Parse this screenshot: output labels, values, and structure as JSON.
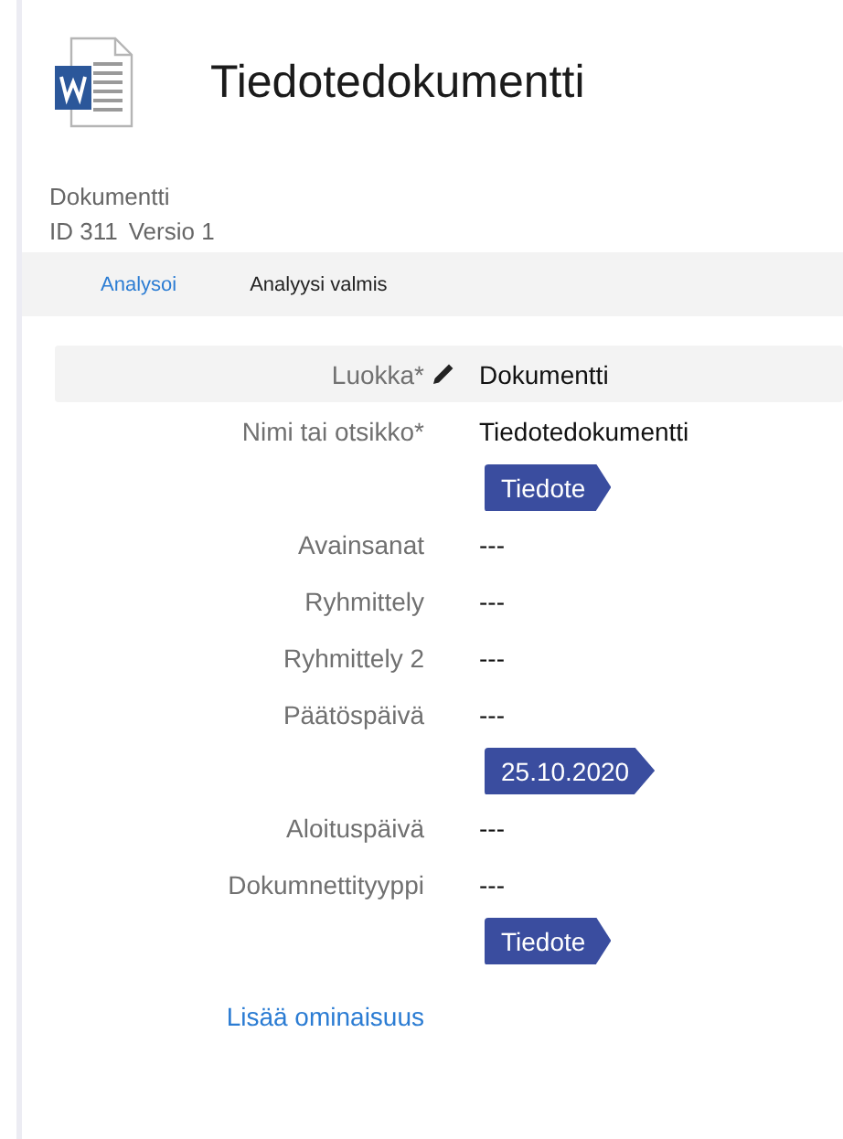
{
  "document": {
    "title": "Tiedotedokumentti",
    "type": "Dokumentti",
    "id": "ID 311",
    "version": "Versio 1"
  },
  "tabs": [
    {
      "label": "Analysoi",
      "selected": true
    },
    {
      "label": "Analyysi valmis",
      "selected": false
    }
  ],
  "properties": [
    {
      "label": "Luokka*",
      "value": "Dokumentti",
      "editable": true,
      "selected": true
    },
    {
      "label": "Nimi tai otsikko*",
      "value": "Tiedotedokumentti",
      "tag": "Tiedote",
      "editable": false,
      "selected": false
    },
    {
      "label": "Avainsanat",
      "value": "---",
      "editable": false,
      "selected": false
    },
    {
      "label": "Ryhmittely",
      "value": "---",
      "editable": false,
      "selected": false
    },
    {
      "label": "Ryhmittely 2",
      "value": "---",
      "editable": false,
      "selected": false
    },
    {
      "label": "Päätöspäivä",
      "value": "---",
      "tag": "25.10.2020",
      "editable": false,
      "selected": false
    },
    {
      "label": "Aloituspäivä",
      "value": "---",
      "editable": false,
      "selected": false
    },
    {
      "label": "Dokumnettityyppi",
      "value": "---",
      "tag": "Tiedote",
      "editable": false,
      "selected": false
    }
  ],
  "add_link": "Lisää ominaisuus"
}
